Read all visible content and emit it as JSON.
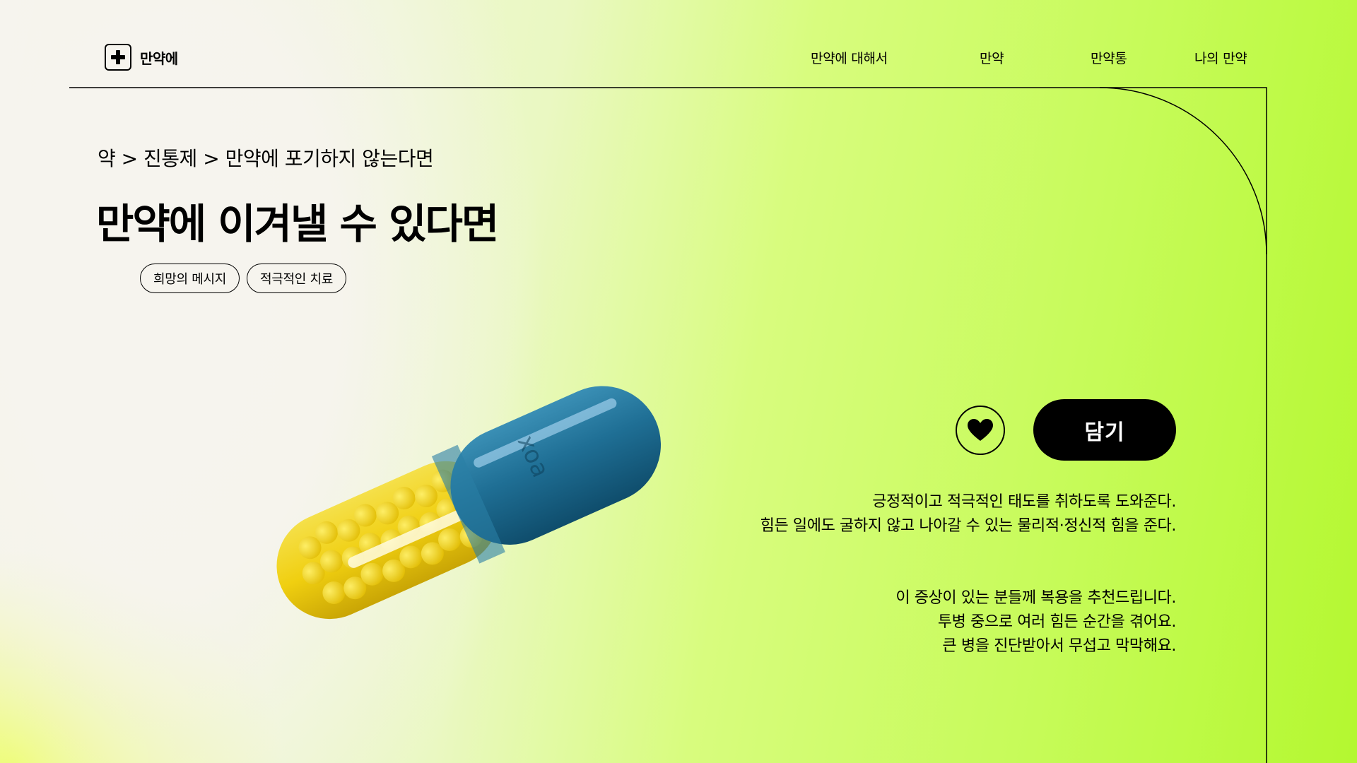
{
  "brand": {
    "name": "만약에",
    "logo_icon": "medical-cross-icon"
  },
  "nav": {
    "items": [
      {
        "label": "만약에 대해서"
      },
      {
        "label": "만약"
      },
      {
        "label": "만약통"
      },
      {
        "label": "나의 만약"
      }
    ]
  },
  "breadcrumb": "약 > 진통제 > 만약에 포기하지 않는다면",
  "title": "만약에 이겨낼 수 있다면",
  "tags": [
    {
      "label": "희망의 메시지"
    },
    {
      "label": "적극적인 치료"
    }
  ],
  "actions": {
    "like_icon": "heart-icon",
    "cart_label": "담기"
  },
  "description": {
    "lines_1": [
      "긍정적이고 적극적인 태도를 취하도록 도와준다.",
      "힘든 일에도 굴하지 않고 나아갈 수 있는 물리적·정신적 힘을 준다."
    ],
    "lines_2": [
      "이 증상이 있는 분들께 복용을 추천드립니다.",
      "투병 중으로 여러 힘든 순간을 겪어요.",
      "큰 병을 진단받아서 무섭고 막막해요."
    ]
  },
  "colors": {
    "accent_green": "#c6fb58",
    "capsule_blue": "#1f6f95",
    "capsule_yellow": "#f2d21a",
    "button_black": "#000000"
  }
}
